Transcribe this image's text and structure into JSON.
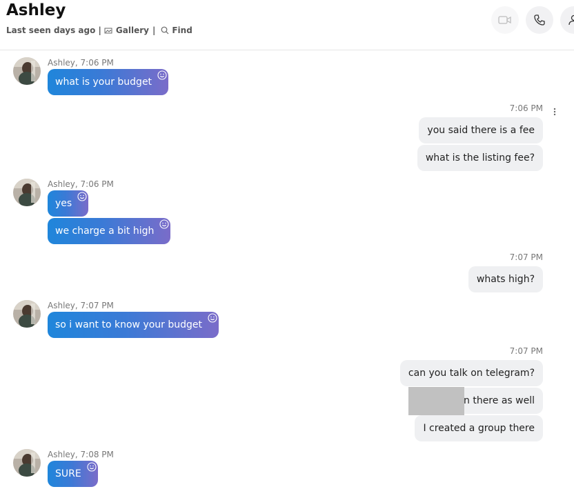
{
  "header": {
    "title": "Ashley",
    "last_seen": "Last seen days ago |",
    "gallery_label": "Gallery",
    "gallery_sep": "|",
    "find_label": "Find"
  },
  "messages": {
    "m1_meta": "Ashley, 7:06 PM",
    "m1_text": "what is your budget",
    "t1": "7:06 PM",
    "o1": "you said there is a fee",
    "o2": "what is the listing fee?",
    "m2_meta": "Ashley, 7:06 PM",
    "m2_text_a": "yes",
    "m2_text_b": "we charge a bit high",
    "t2": "7:07 PM",
    "o3": "whats high?",
    "m3_meta": "Ashley, 7:07 PM",
    "m3_text": "so i want to know your budget",
    "t3": "7:07 PM",
    "o4": "can you talk on telegram?",
    "o5": "s on there as well",
    "o6": "I created a group there",
    "m4_meta": "Ashley, 7:08 PM",
    "m4_text": "SURE"
  },
  "colors": {
    "incoming_start": "#1f86db",
    "incoming_end": "#7a6cc9",
    "outgoing_bg": "#eff0f2"
  },
  "icons": [
    "gallery-icon",
    "search-icon",
    "video-call-icon",
    "phone-icon",
    "person-icon",
    "smiley-icon",
    "more-options-icon"
  ]
}
